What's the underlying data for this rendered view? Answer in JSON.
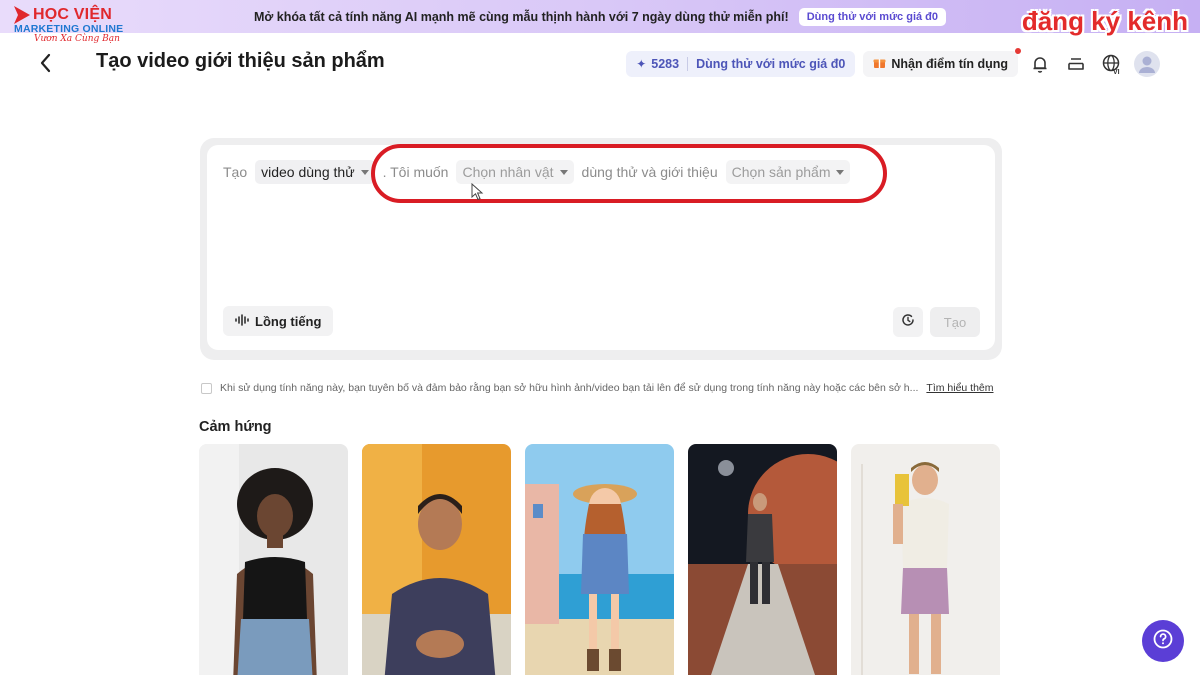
{
  "banner": {
    "text": "Mở khóa tất cả tính năng AI mạnh mẽ cùng mẫu thịnh hành với 7 ngày dùng thử miễn phí!",
    "cta": "Dùng thử với mức giá đ0"
  },
  "logo": {
    "name": "HỌC VIỆN",
    "sub": "MARKETING ONLINE",
    "tagline": "Vươn Xa Cùng Bạn"
  },
  "watermark": "đăng ký kênh",
  "header": {
    "title": "Tạo video giới thiệu sản phẩm",
    "credits": "5283",
    "trial_cta": "Dùng thử với mức giá đ0",
    "points_cta": "Nhận điểm tín dụng",
    "language": "VI"
  },
  "prompt": {
    "prefix": "Tạo",
    "type_value": "video dùng thử",
    "mid1": ". Tôi muốn",
    "character_placeholder": "Chọn nhân vật",
    "mid2": "dùng thử và giới thiệu",
    "product_placeholder": "Chọn sản phẩm",
    "voice_label": "Lồng tiếng",
    "create_label": "Tạo"
  },
  "disclaimer": {
    "text": "Khi sử dụng tính năng này, bạn tuyên bố và đảm bảo rằng bạn sở hữu hình ảnh/video bạn tải lên để sử dụng trong tính năng này hoặc các bên sở h...",
    "link": "Tìm hiểu thêm"
  },
  "inspiration": {
    "title": "Cảm hứng"
  },
  "colors": {
    "accent": "#4d55b8",
    "highlight": "#d91c24",
    "help": "#5b3ed6"
  }
}
